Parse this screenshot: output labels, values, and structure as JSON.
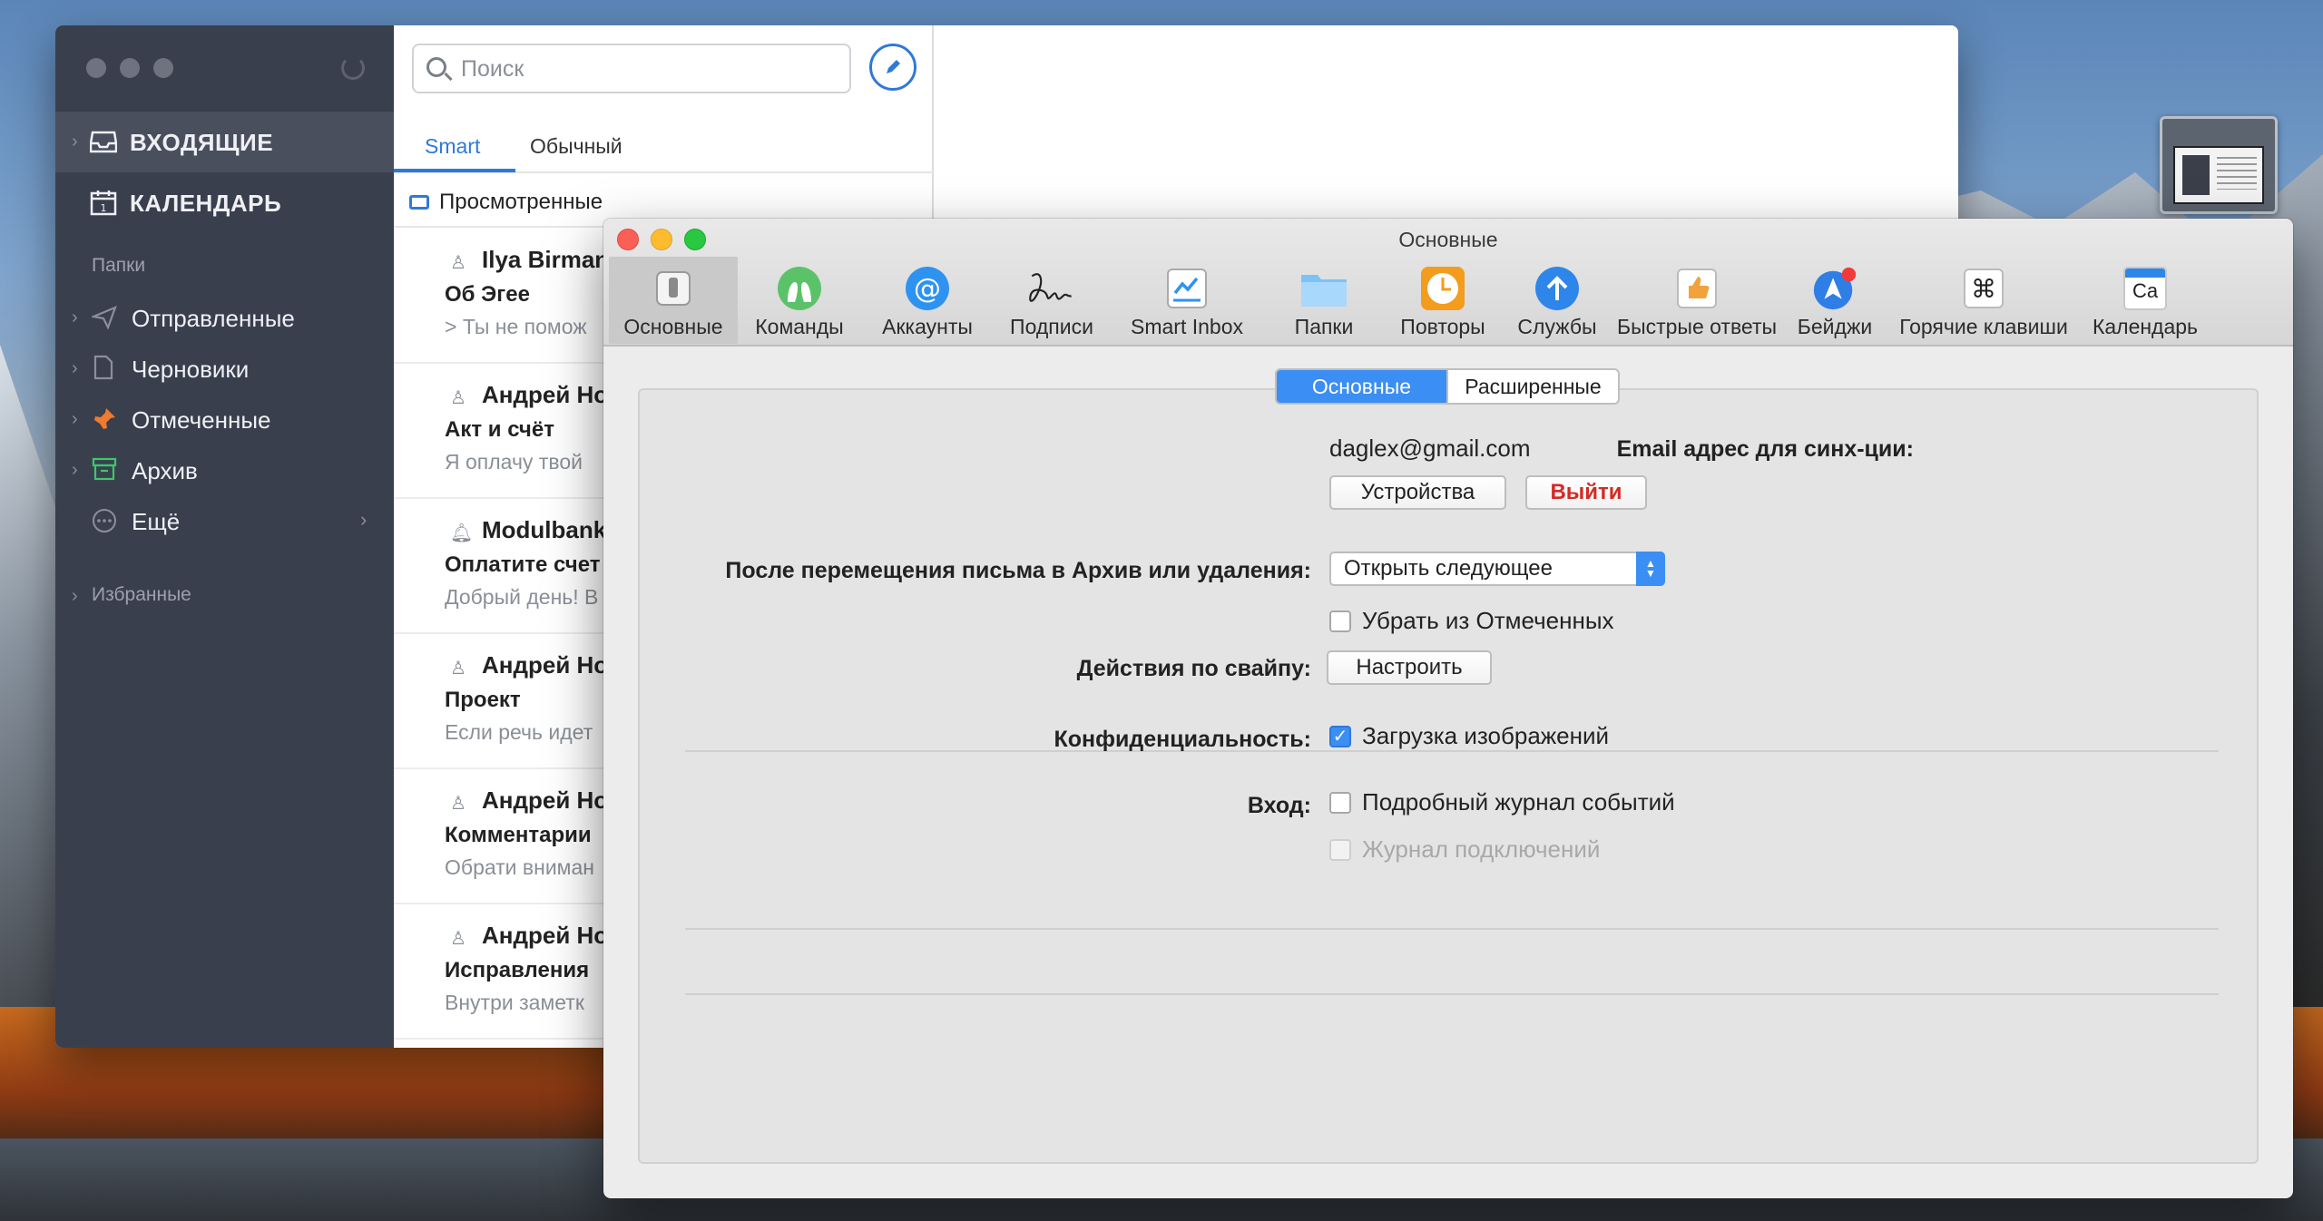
{
  "sidebar": {
    "inbox_label": "ВХОДЯЩИЕ",
    "calendar_label": "КАЛЕНДАРЬ",
    "folders_heading": "Папки",
    "folders": [
      {
        "label": "Отправленные",
        "icon": "send-icon"
      },
      {
        "label": "Черновики",
        "icon": "draft-icon"
      },
      {
        "label": "Отмеченные",
        "icon": "pin-icon"
      },
      {
        "label": "Архив",
        "icon": "archive-icon"
      },
      {
        "label": "Ещё",
        "icon": "more-icon"
      }
    ],
    "favorites_heading": "Избранные"
  },
  "message_list": {
    "search_placeholder": "Поиск",
    "tabs": [
      "Smart",
      "Обычный"
    ],
    "group_label": "Просмотренные",
    "messages": [
      {
        "sender": "Ilya Birman",
        "subject": "Об Эгее",
        "preview": "> Ты не помож"
      },
      {
        "sender": "Андрей Но",
        "subject": "Акт и счёт",
        "preview": "Я оплачу твой"
      },
      {
        "sender": "Modulbank",
        "subject": "Оплатите счет",
        "preview": "Добрый день! В"
      },
      {
        "sender": "Андрей Но",
        "subject": "Проект",
        "preview": "Если речь идет"
      },
      {
        "sender": "Андрей Но",
        "subject": "Комментарии",
        "preview": "Обрати вниман"
      },
      {
        "sender": "Андрей Но",
        "subject": "Исправления",
        "preview": "Внутри заметк"
      }
    ]
  },
  "prefs": {
    "window_title": "Основные",
    "toolbar": [
      {
        "label": "Основные"
      },
      {
        "label": "Команды"
      },
      {
        "label": "Аккаунты"
      },
      {
        "label": "Подписи"
      },
      {
        "label": "Smart Inbox"
      },
      {
        "label": "Папки"
      },
      {
        "label": "Повторы"
      },
      {
        "label": "Службы"
      },
      {
        "label": "Быстрые ответы"
      },
      {
        "label": "Бейджи"
      },
      {
        "label": "Горячие клавиши"
      },
      {
        "label": "Календарь",
        "icon_text": "Ca"
      }
    ],
    "segments": [
      "Основные",
      "Расширенные"
    ],
    "sync_label": "Email адрес для синх-ции:",
    "sync_email": "daglex@gmail.com",
    "devices_button": "Устройства",
    "logout_button": "Выйти",
    "after_move_label": "После перемещения письма в Архив или удаления:",
    "after_move_value": "Открыть следующее",
    "remove_from_flagged": "Убрать из Отмеченных",
    "swipe_label": "Действия по свайпу:",
    "swipe_button": "Настроить",
    "privacy_label": "Конфиденциальность:",
    "load_images": "Загрузка изображений",
    "login_label": "Вход:",
    "detailed_log": "Подробный журнал событий",
    "connection_log": "Журнал подключений"
  }
}
